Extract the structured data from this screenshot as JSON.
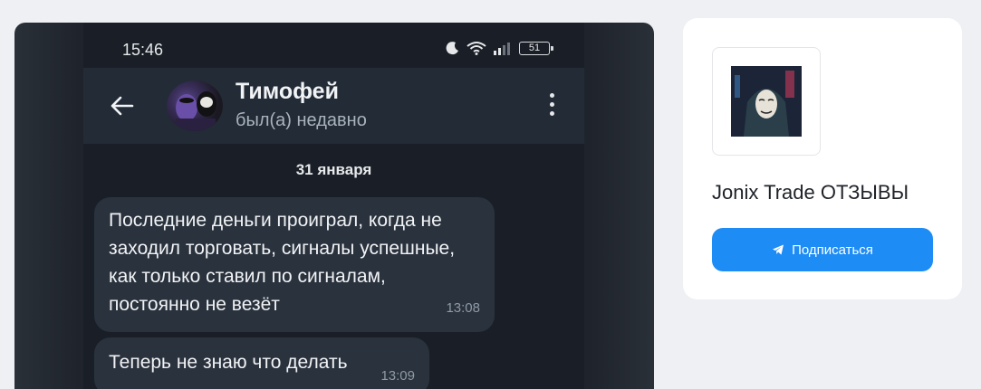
{
  "post_image": {
    "status_bar": {
      "time": "15:46",
      "battery": "51"
    },
    "chat_header": {
      "contact_name": "Тимофей",
      "contact_status": "был(а) недавно"
    },
    "date_separator": "31 января",
    "messages": [
      {
        "text": "Последние деньги проиграл, когда не заходил торговать, сигналы успешные, как только ставил по сигналам, постоянно не везёт",
        "time": "13:08"
      },
      {
        "text": "Теперь не знаю что делать",
        "time": "13:09"
      }
    ]
  },
  "channel": {
    "name": "Jonix Trade ОТЗЫВЫ",
    "subscribe_label": "Подписаться"
  },
  "colors": {
    "accent": "#1e8cf5",
    "page_bg": "#eef0f4",
    "chat_bg": "#1a1f27",
    "bubble_bg": "#2a323d"
  }
}
